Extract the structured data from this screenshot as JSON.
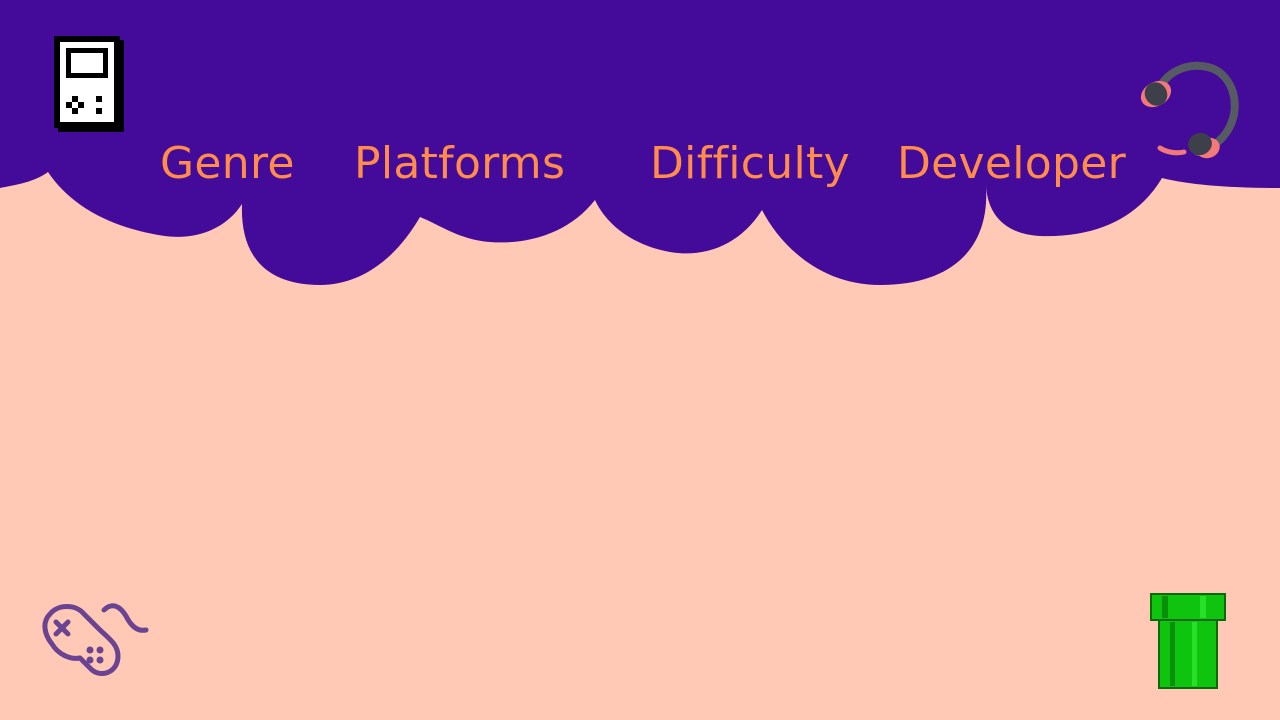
{
  "colors": {
    "background": "#ffc9b5",
    "header": "#440a9a",
    "nav_text": "#ff8c4a",
    "pipe_green": "#0fc40f",
    "pipe_dark": "#0a8f0a",
    "gamepad_stroke": "#6b4393",
    "headset_band": "#555a63",
    "headset_cushion": "#f2797a"
  },
  "nav": {
    "items": [
      {
        "label": "Genre"
      },
      {
        "label": "Platforms"
      },
      {
        "label": "Difficulty"
      },
      {
        "label": "Developer"
      }
    ]
  },
  "decorations": {
    "top_left": "handheld-console-icon",
    "top_right": "headset-icon",
    "bottom_left": "gamepad-icon",
    "bottom_right": "warp-pipe-icon"
  }
}
